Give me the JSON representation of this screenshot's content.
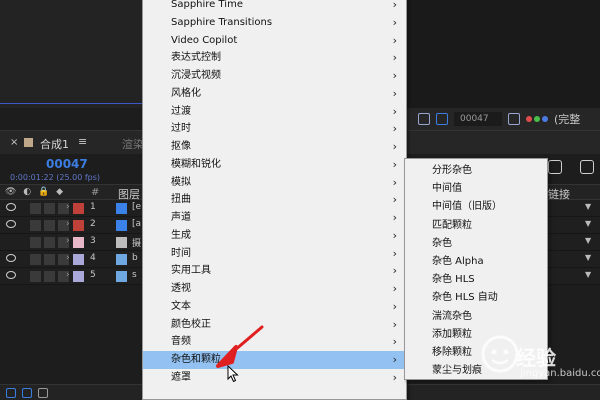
{
  "viewer_toolbar": {
    "frame": "00047",
    "full_label": "(完整"
  },
  "composition": {
    "close": "×",
    "name": "合成1",
    "menu": "≡",
    "render_tab": "渲染"
  },
  "timecode": {
    "frame": "00047",
    "sub": "0:00:01:22 (25.00 fps)"
  },
  "columns": {
    "num": "#",
    "layer": "图层",
    "link": "链接"
  },
  "layers": [
    {
      "num": "1",
      "name": "[e",
      "label_color": "#c0413a",
      "type_color": "#3b82e8"
    },
    {
      "num": "2",
      "name": "[a",
      "label_color": "#c0413a",
      "type_color": "#3b82e8"
    },
    {
      "num": "3",
      "name": "摄",
      "label_color": "#e8b8c8",
      "type_color": "#bdbdbd"
    },
    {
      "num": "4",
      "name": "b",
      "label_color": "#a9a8d8",
      "type_color": "#6fa8e0"
    },
    {
      "num": "5",
      "name": "s",
      "label_color": "#a9a8d8",
      "type_color": "#6fa8e0"
    }
  ],
  "main_menu": [
    {
      "label": "Sapphire Time",
      "submenu": true
    },
    {
      "label": "Sapphire Transitions",
      "submenu": true
    },
    {
      "label": "Video Copilot",
      "submenu": true
    },
    {
      "label": "表达式控制",
      "submenu": true
    },
    {
      "label": "沉浸式视频",
      "submenu": true
    },
    {
      "label": "风格化",
      "submenu": true
    },
    {
      "label": "过渡",
      "submenu": true
    },
    {
      "label": "过时",
      "submenu": true
    },
    {
      "label": "抠像",
      "submenu": true
    },
    {
      "label": "模糊和锐化",
      "submenu": true
    },
    {
      "label": "模拟",
      "submenu": true
    },
    {
      "label": "扭曲",
      "submenu": true
    },
    {
      "label": "声道",
      "submenu": true
    },
    {
      "label": "生成",
      "submenu": true
    },
    {
      "label": "时间",
      "submenu": true
    },
    {
      "label": "实用工具",
      "submenu": true
    },
    {
      "label": "透视",
      "submenu": true
    },
    {
      "label": "文本",
      "submenu": true
    },
    {
      "label": "颜色校正",
      "submenu": true
    },
    {
      "label": "音频",
      "submenu": true
    },
    {
      "label": "杂色和颗粒",
      "submenu": true,
      "highlight": true
    },
    {
      "label": "遮罩",
      "submenu": true
    }
  ],
  "sub_menu": [
    {
      "label": "分形杂色"
    },
    {
      "label": "中间值"
    },
    {
      "label": "中间值（旧版）"
    },
    {
      "label": "匹配颗粒"
    },
    {
      "label": "杂色"
    },
    {
      "label": "杂色 Alpha"
    },
    {
      "label": "杂色 HLS"
    },
    {
      "label": "杂色 HLS 自动"
    },
    {
      "label": "湍流杂色"
    },
    {
      "label": "添加颗粒"
    },
    {
      "label": "移除颗粒"
    },
    {
      "label": "蒙尘与划痕"
    }
  ],
  "watermark": {
    "text": "经验",
    "sub": "jingyan.baidu.com"
  },
  "colors": {
    "menu_bg": "#f0f0f0",
    "highlight": "#93c2f2",
    "accent_blue": "#3b7de0",
    "annotation_red": "#e02020"
  }
}
